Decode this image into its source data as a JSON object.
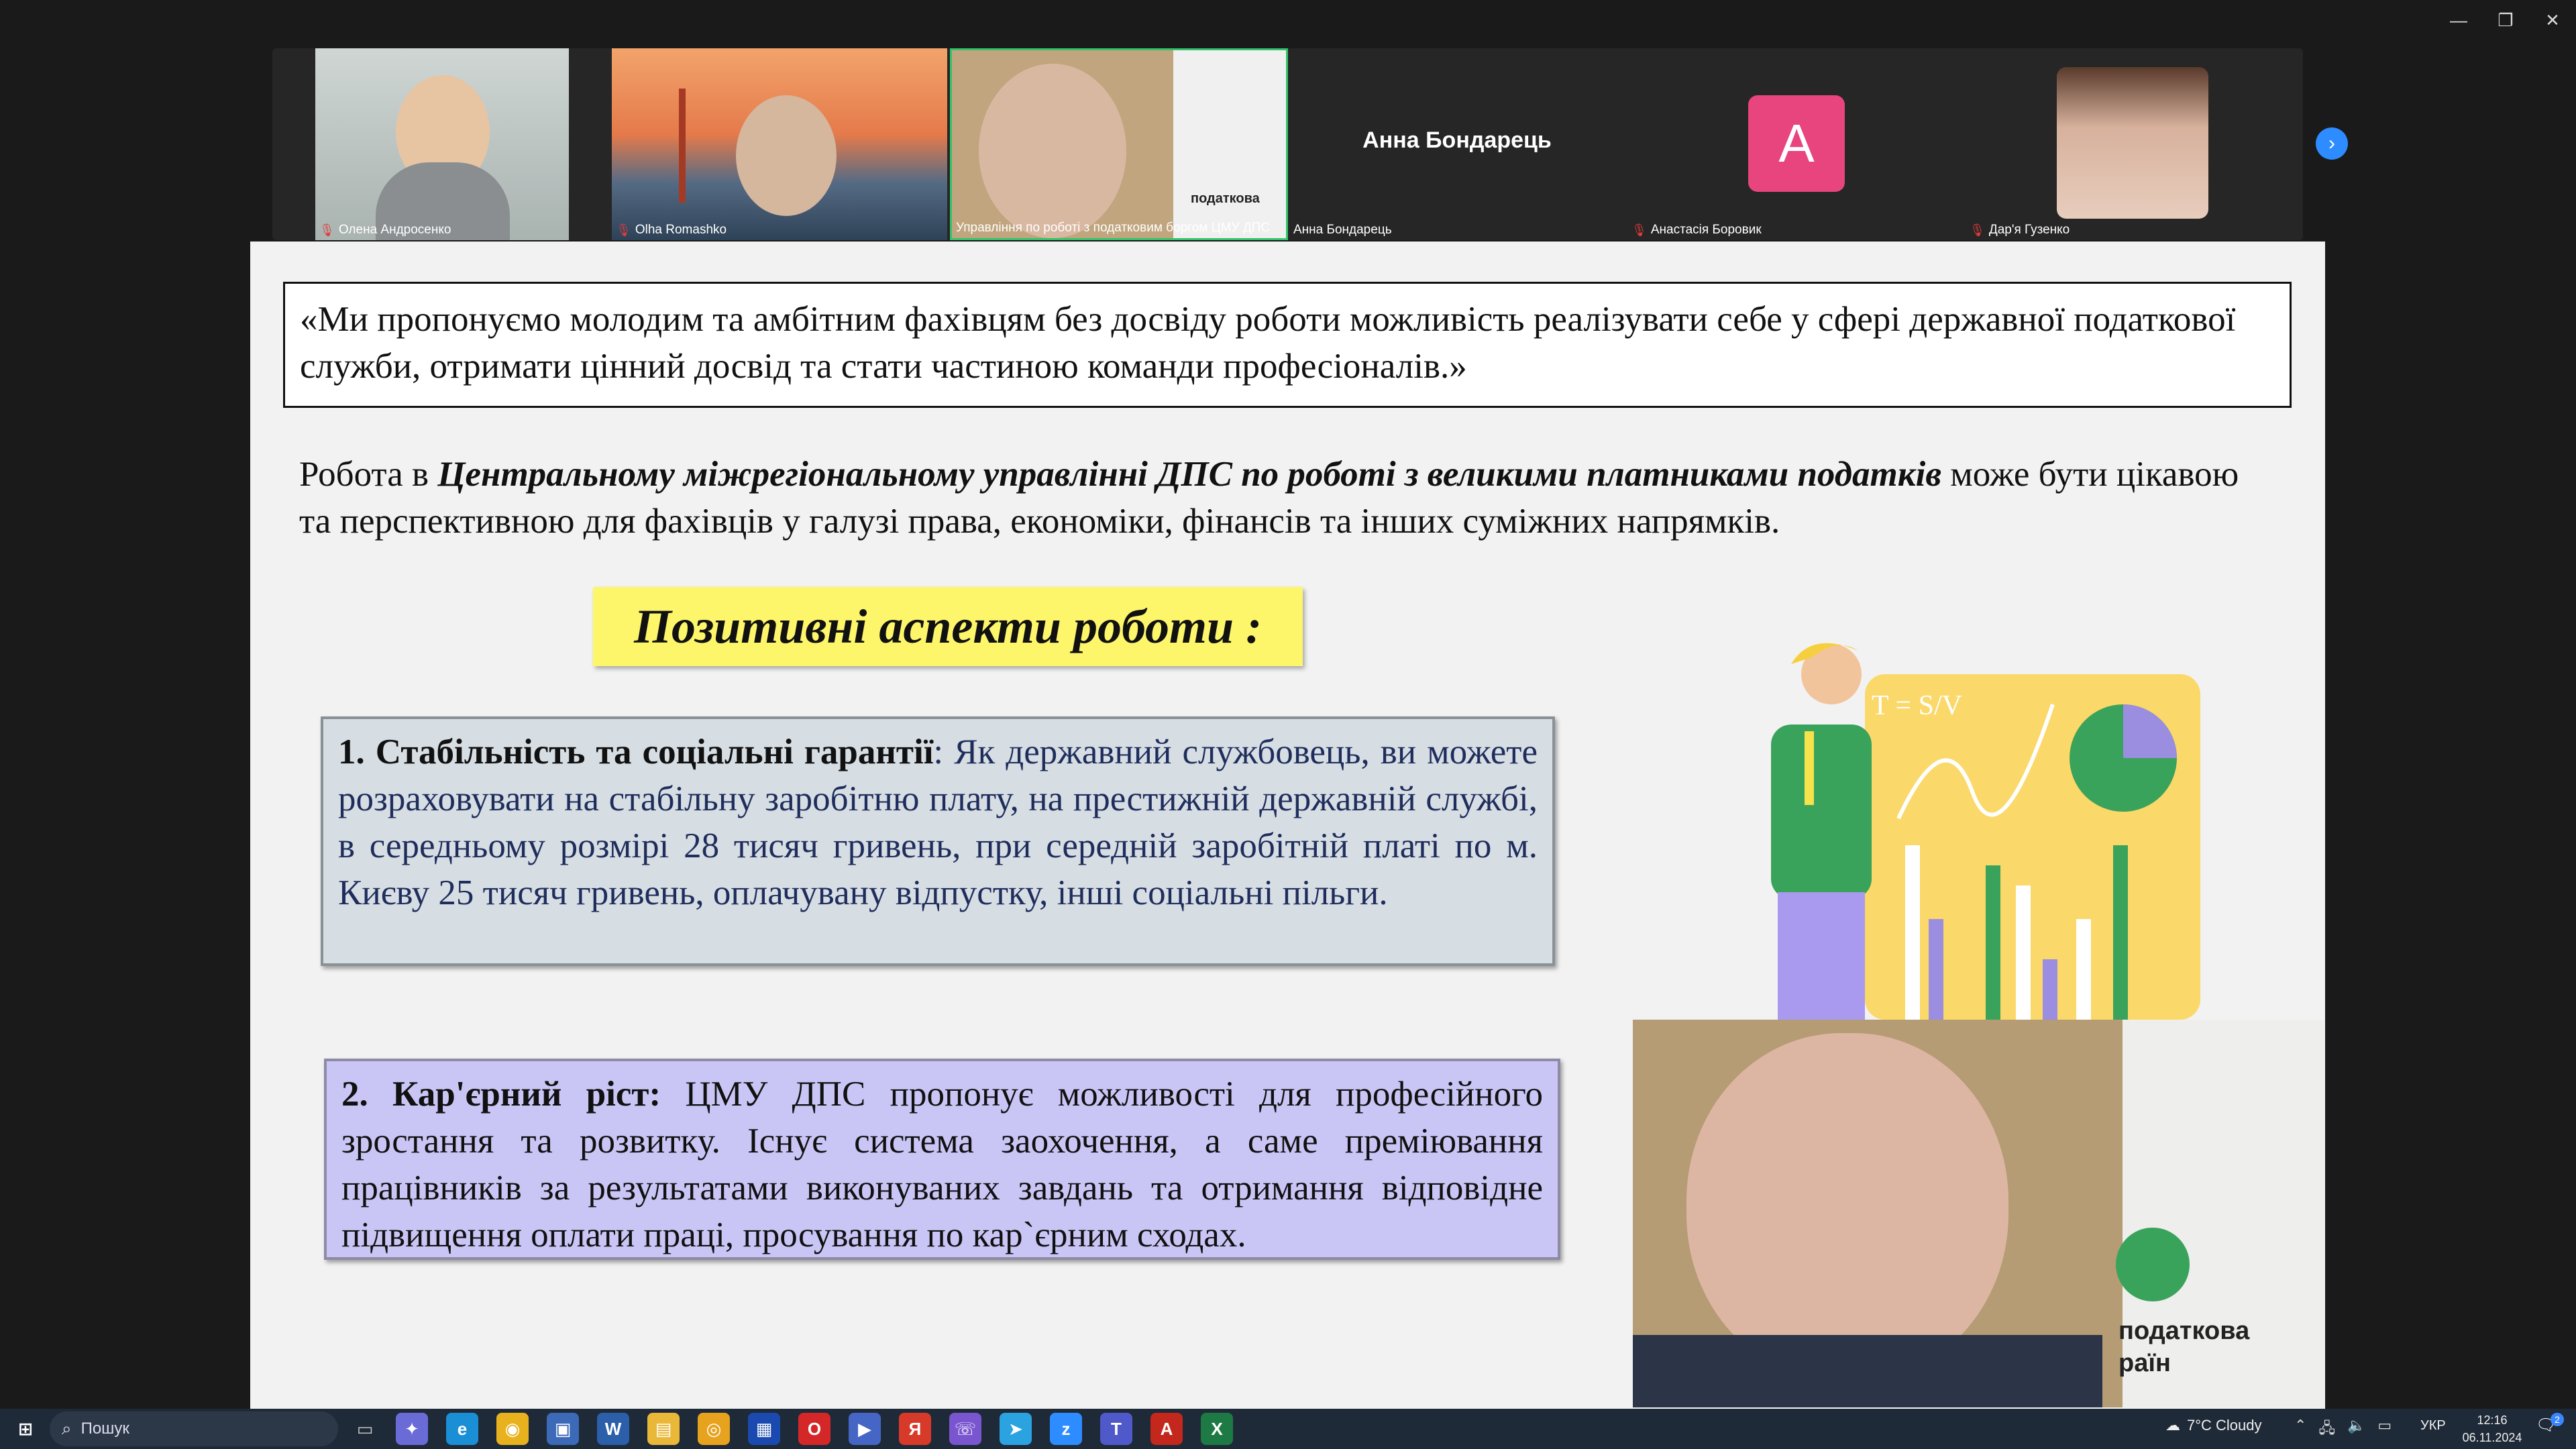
{
  "window": {
    "minimize": "—",
    "restore": "❐",
    "close": "✕"
  },
  "participants": [
    {
      "name": "Олена Андросенко"
    },
    {
      "name": "Olha Romashko"
    },
    {
      "name": "Управління по роботі з податковим боргом ЦМУ ДПС",
      "bg_text": "податкова"
    },
    {
      "name": "Анна Бондарець",
      "title": "Анна Бондарець"
    },
    {
      "name": "Анастасія Боровик",
      "initial": "A"
    },
    {
      "name": "Дар'я Гузенко"
    }
  ],
  "slide": {
    "quote": "«Ми пропонуємо молодим та амбітним фахівцям без досвіду роботи можливість реалізувати себе у сфері державної податкової служби, отримати цінний досвід та стати частиною команди професіоналів.»",
    "para_start": "Робота в ",
    "para_bold": "Центральному міжрегіональному управлінні ДПС по роботі з великими платниками податків",
    "para_end": " може бути цікавою та перспективною для фахівців у галузі права, економіки, фінансів та інших суміжних напрямків.",
    "heading": "Позитивні аспекти роботи :",
    "item1_title": "1. Стабільність та соціальні гарантії",
    "item1_text": ": Як державний службовець, ви можете розраховувати на стабільну заробітню плату, на престижній державній службі, в середньому розмірі 28 тисяч гривень, при середній заробітній платі по м. Києву 25 тисяч гривень, оплачувану відпустку, інші соціальні пільги.",
    "item2_title": "2. Кар'єрний ріст:",
    "item2_text": " ЦМУ ДПС пропонує можливості для професійного зростання та розвитку. Існує система заохочення, а саме преміювання працівників за результатами виконуваних завдань та отримання відповідне підвищення оплати праці, просування по кар`єрним сходах.",
    "illustration_text": "T = S/V"
  },
  "speaker": {
    "bg_text": "податкова\nраїн"
  },
  "taskbar": {
    "search": "Пошук",
    "weather": "7°C  Cloudy",
    "lang": "УКР",
    "time": "12:16",
    "date": "06.11.2024",
    "notif_count": "2"
  },
  "colors": {
    "accent_green": "#3aa35b",
    "avatar_pink": "#e8457f",
    "heading_yellow": "#fdf66b",
    "box1": "#d6dde3",
    "box2": "#c9c6f6"
  }
}
